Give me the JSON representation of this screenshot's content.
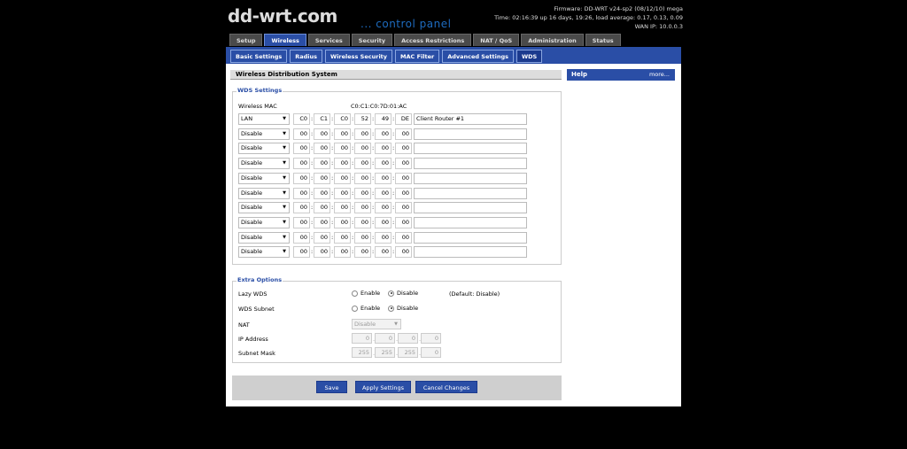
{
  "header": {
    "logo": "dd-wrt.com",
    "subtitle": "... control panel",
    "firmware": "Firmware: DD-WRT v24-sp2 (08/12/10) mega",
    "time": "Time: 02:16:39 up 16 days, 19:26, load average: 0.17, 0.13, 0.09",
    "wan_ip": "WAN IP: 10.0.0.3"
  },
  "main_tabs": [
    "Setup",
    "Wireless",
    "Services",
    "Security",
    "Access Restrictions",
    "NAT / QoS",
    "Administration",
    "Status"
  ],
  "active_main_tab": "Wireless",
  "sub_tabs": [
    "Basic Settings",
    "Radius",
    "Wireless Security",
    "MAC Filter",
    "Advanced Settings",
    "WDS"
  ],
  "active_sub_tab": "WDS",
  "section_title": "Wireless Distribution System",
  "wds": {
    "legend": "WDS Settings",
    "wireless_mac_label": "Wireless MAC",
    "wireless_mac_value": "C0:C1:C0:7D:01:AC",
    "rows": [
      {
        "mode": "LAN",
        "mac": [
          "C0",
          "C1",
          "C0",
          "52",
          "49",
          "DE"
        ],
        "name": "Client Router #1"
      },
      {
        "mode": "Disable",
        "mac": [
          "00",
          "00",
          "00",
          "00",
          "00",
          "00"
        ],
        "name": ""
      },
      {
        "mode": "Disable",
        "mac": [
          "00",
          "00",
          "00",
          "00",
          "00",
          "00"
        ],
        "name": ""
      },
      {
        "mode": "Disable",
        "mac": [
          "00",
          "00",
          "00",
          "00",
          "00",
          "00"
        ],
        "name": ""
      },
      {
        "mode": "Disable",
        "mac": [
          "00",
          "00",
          "00",
          "00",
          "00",
          "00"
        ],
        "name": ""
      },
      {
        "mode": "Disable",
        "mac": [
          "00",
          "00",
          "00",
          "00",
          "00",
          "00"
        ],
        "name": ""
      },
      {
        "mode": "Disable",
        "mac": [
          "00",
          "00",
          "00",
          "00",
          "00",
          "00"
        ],
        "name": ""
      },
      {
        "mode": "Disable",
        "mac": [
          "00",
          "00",
          "00",
          "00",
          "00",
          "00"
        ],
        "name": ""
      },
      {
        "mode": "Disable",
        "mac": [
          "00",
          "00",
          "00",
          "00",
          "00",
          "00"
        ],
        "name": ""
      },
      {
        "mode": "Disable",
        "mac": [
          "00",
          "00",
          "00",
          "00",
          "00",
          "00"
        ],
        "name": ""
      }
    ]
  },
  "extra": {
    "legend": "Extra Options",
    "lazy_wds_label": "Lazy WDS",
    "wds_subnet_label": "WDS Subnet",
    "enable_label": "Enable",
    "disable_label": "Disable",
    "default_note": "(Default: Disable)",
    "nat_label": "NAT",
    "nat_value": "Disable",
    "ip_label": "IP Address",
    "ip_value": [
      "0",
      "0",
      "0",
      "0"
    ],
    "mask_label": "Subnet Mask",
    "mask_value": [
      "255",
      "255",
      "255",
      "0"
    ]
  },
  "buttons": {
    "save": "Save",
    "apply": "Apply Settings",
    "cancel": "Cancel Changes"
  },
  "help": {
    "title": "Help",
    "more": "more..."
  }
}
